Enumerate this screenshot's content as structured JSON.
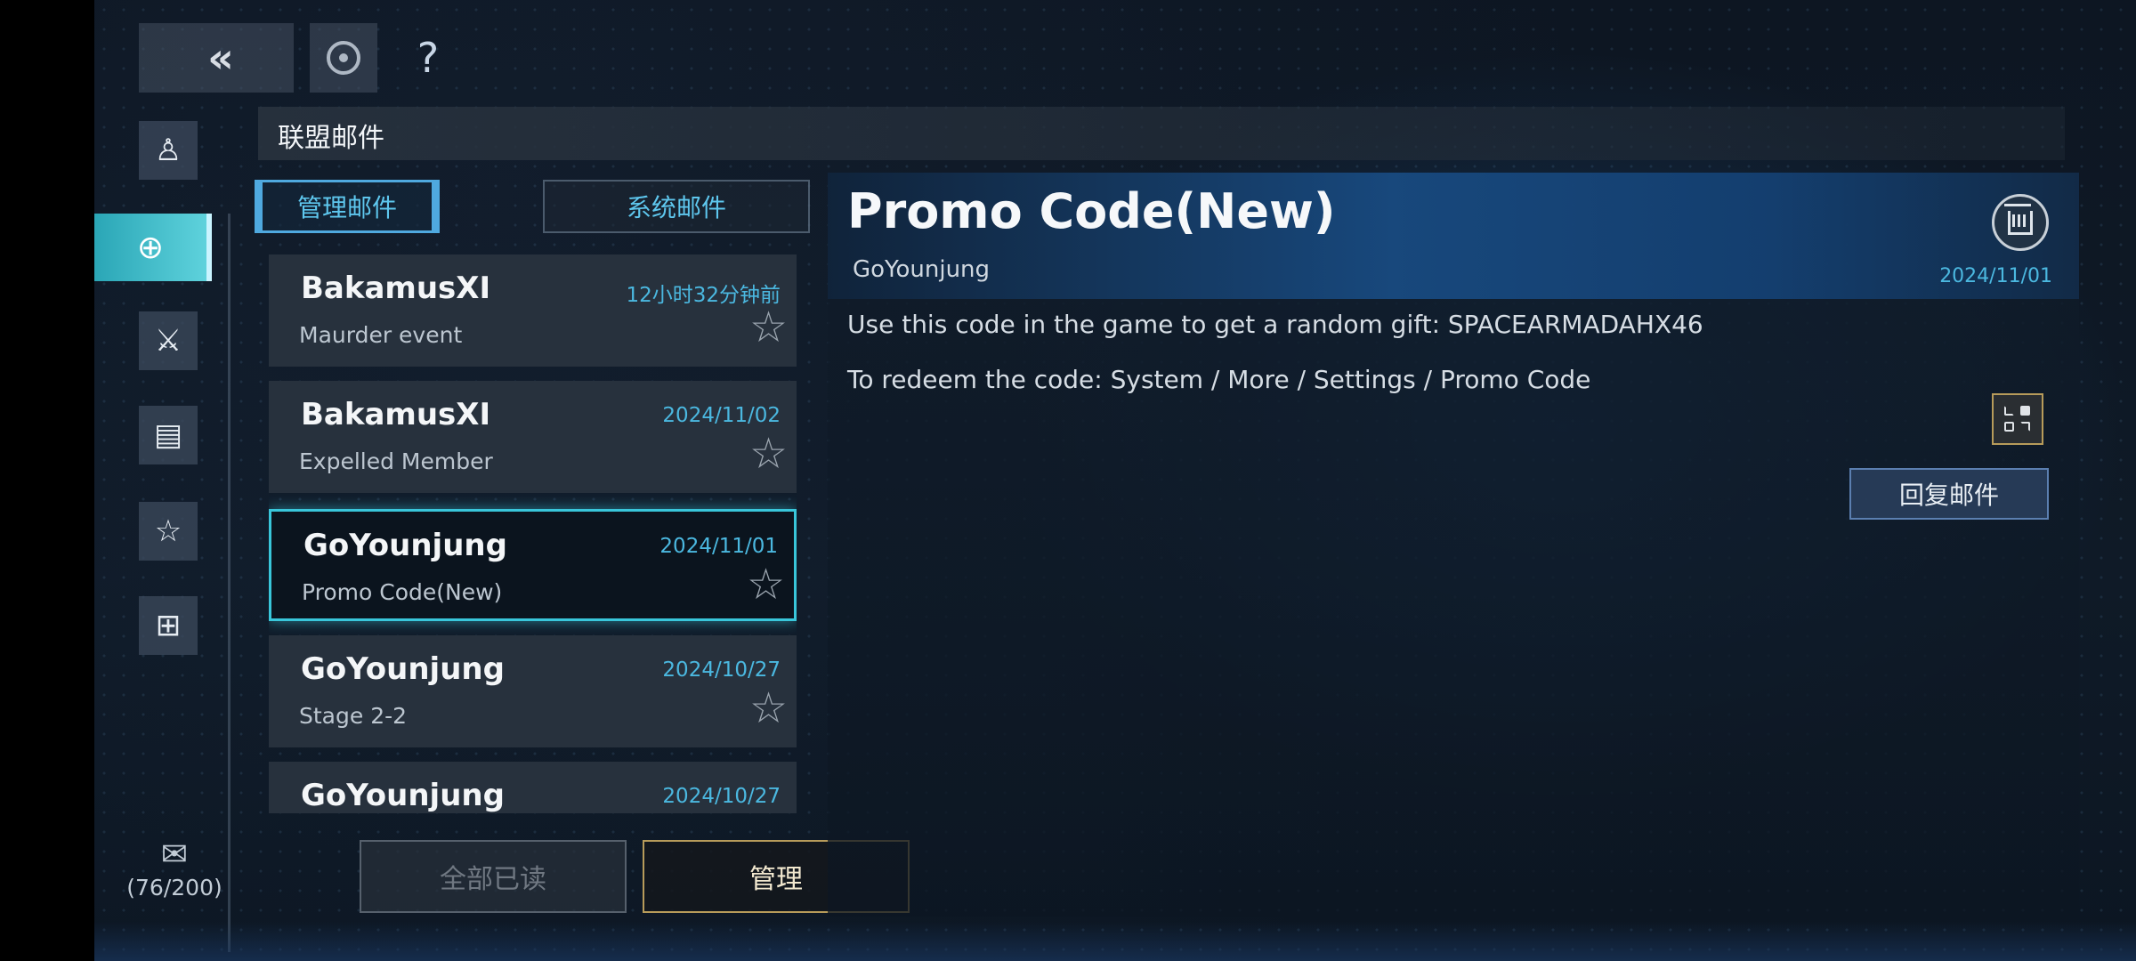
{
  "top_bar": {
    "back_icon": "double-chevron-left-icon",
    "refresh_icon": "refresh-ring-icon",
    "help_label": "?"
  },
  "sidebar": {
    "items": [
      {
        "icon": "person-icon",
        "glyph": "♙",
        "active": false
      },
      {
        "icon": "globe-icon",
        "glyph": "⊕",
        "active": true
      },
      {
        "icon": "crossed-swords-icon",
        "glyph": "⚔",
        "active": false
      },
      {
        "icon": "document-icon",
        "glyph": "▤",
        "active": false
      },
      {
        "icon": "star-icon",
        "glyph": "☆",
        "active": false
      },
      {
        "icon": "gift-icon",
        "glyph": "⊞",
        "active": false
      }
    ],
    "mail_counter": "(76/200)"
  },
  "header": {
    "title": "联盟邮件"
  },
  "tabs": [
    {
      "label": "管理邮件",
      "active": true
    },
    {
      "label": "系统邮件",
      "active": false
    }
  ],
  "mails": [
    {
      "sender": "BakamusXI",
      "time": "12小时32分钟前",
      "subject": "Maurder event",
      "selected": false
    },
    {
      "sender": "BakamusXI",
      "time": "2024/11/02",
      "subject": "Expelled Member",
      "selected": false
    },
    {
      "sender": "GoYounjung",
      "time": "2024/11/01",
      "subject": "Promo Code(New)",
      "selected": true
    },
    {
      "sender": "GoYounjung",
      "time": "2024/10/27",
      "subject": "Stage 2-2",
      "selected": false
    },
    {
      "sender": "GoYounjung",
      "time": "2024/10/27",
      "subject": "",
      "selected": false
    }
  ],
  "actions": {
    "read_all": "全部已读",
    "manage": "管理"
  },
  "detail": {
    "title": "Promo Code(New)",
    "sender": "GoYounjung",
    "date": "2024/11/01",
    "body": [
      "Use this code in the game to get a random gift: SPACEARMADAHX46",
      "To redeem the code: System / More / Settings / Promo Code"
    ],
    "reply_label": "回复邮件"
  },
  "colors": {
    "accent": "#39c6da",
    "date_text": "#4bb8e0",
    "gold_border": "#b79b5a"
  }
}
